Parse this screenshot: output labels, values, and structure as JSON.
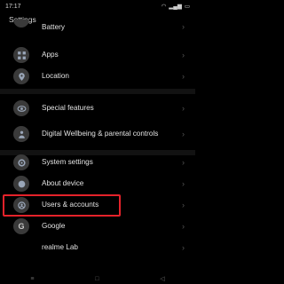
{
  "status_bar": {
    "time": "17:17",
    "icons": [
      "wifi-icon",
      "signal-icon",
      "battery-icon"
    ]
  },
  "header": {
    "title": "Settings"
  },
  "items": [
    {
      "label": "Battery",
      "icon": "battery-icon"
    },
    {
      "label": "Apps",
      "icon": "apps-grid-icon"
    },
    {
      "label": "Location",
      "icon": "location-pin-icon"
    },
    {
      "label": "Special features",
      "icon": "special-features-icon"
    },
    {
      "label": "Digital Wellbeing & parental controls",
      "icon": "wellbeing-icon"
    },
    {
      "label": "System settings",
      "icon": "system-settings-icon"
    },
    {
      "label": "About device",
      "icon": "about-device-icon"
    },
    {
      "label": "Users & accounts",
      "icon": "users-icon"
    },
    {
      "label": "Google",
      "icon": "google-g-icon"
    },
    {
      "label": "realme Lab",
      "icon": "lab-icon"
    }
  ],
  "colors": {
    "background": "#000000",
    "highlight_box": "#e5222a",
    "icon_bg": "#3a3a3a"
  }
}
